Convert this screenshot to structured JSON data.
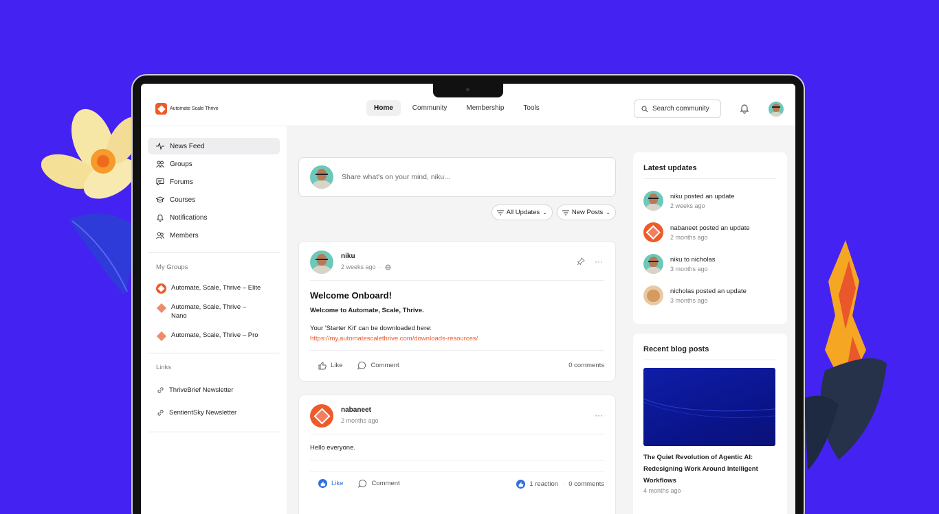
{
  "brand": {
    "name": "Automate Scale Thrive",
    "accent": "#ef5a2b",
    "background": "#4422f2"
  },
  "nav": {
    "items": [
      "Home",
      "Community",
      "Membership",
      "Tools"
    ],
    "active": "Home"
  },
  "search": {
    "label": "Search community"
  },
  "sidebar": {
    "items": [
      {
        "label": "News Feed",
        "icon": "activity-icon"
      },
      {
        "label": "Groups",
        "icon": "groups-icon"
      },
      {
        "label": "Forums",
        "icon": "forums-icon"
      },
      {
        "label": "Courses",
        "icon": "courses-icon"
      },
      {
        "label": "Notifications",
        "icon": "bell-icon"
      },
      {
        "label": "Members",
        "icon": "members-icon"
      }
    ],
    "my_groups_heading": "My Groups",
    "groups": [
      "Automate, Scale, Thrive – Elite",
      "Automate, Scale, Thrive – Nano",
      "Automate, Scale, Thrive – Pro"
    ],
    "links_heading": "Links",
    "links": [
      "ThriveBrief Newsletter",
      "SentientSky Newsletter"
    ]
  },
  "compose": {
    "placeholder": "Share what's on your mind, niku..."
  },
  "filters": {
    "all_updates": "All Updates",
    "new_posts": "New Posts"
  },
  "posts": [
    {
      "author": "niku",
      "time": "2 weeks ago",
      "title": "Welcome Onboard!",
      "bold": "Welcome to Automate, Scale, Thrive.",
      "text": "Your 'Starter Kit' can be downloaded here:",
      "link": "https://my.automatescalethrive.com/downloads-resources/",
      "like": "Like",
      "comment": "Comment",
      "comments": "0 comments"
    },
    {
      "author": "nabaneet",
      "time": "2 months ago",
      "text": "Hello everyone.",
      "like": "Like",
      "comment": "Comment",
      "reactions": "1 reaction",
      "comments": "0 comments"
    }
  ],
  "latest_updates": {
    "title": "Latest updates",
    "items": [
      {
        "text": "niku posted an update",
        "time": "2 weeks ago"
      },
      {
        "text": "nabaneet posted an update",
        "time": "2 months ago"
      },
      {
        "text": "niku to nicholas",
        "time": "3 months ago"
      },
      {
        "text": "nicholas posted an update",
        "time": "3 months ago"
      }
    ]
  },
  "recent_blog": {
    "title": "Recent blog posts",
    "post_title": "The Quiet Revolution of Agentic AI: Redesigning Work Around Intelligent Workflows",
    "post_time": "4 months ago"
  }
}
